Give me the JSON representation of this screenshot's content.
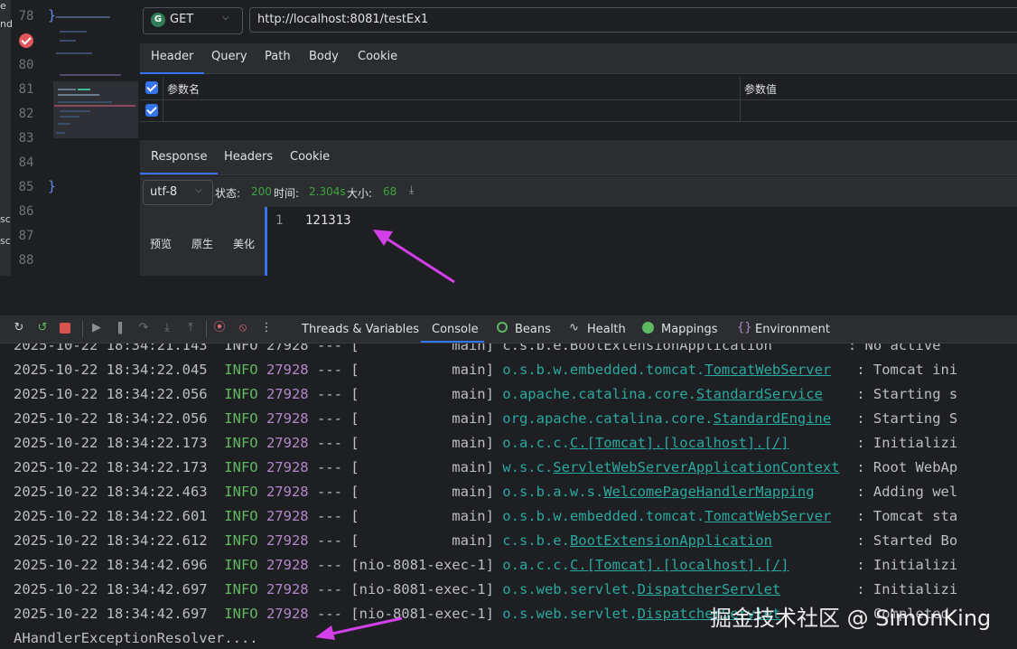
{
  "editor": {
    "line_numbers": [
      "78",
      "80",
      "81",
      "82",
      "83",
      "84",
      "85",
      "86",
      "87",
      "88"
    ],
    "closing_brace": "}",
    "edge_letters": [
      "e",
      "nd",
      "sc",
      "sc"
    ]
  },
  "request": {
    "method": "GET",
    "method_icon_letter": "G",
    "url": "http://localhost:8081/testEx1",
    "tabs": [
      "Header",
      "Query",
      "Path",
      "Body",
      "Cookie"
    ],
    "params_col_name": "参数名",
    "params_col_value": "参数值"
  },
  "response": {
    "tabs": [
      "Response",
      "Headers",
      "Cookie"
    ],
    "encoding": "utf-8",
    "status_label": "状态:",
    "status_value": "200",
    "time_label": "时间:",
    "time_value": "2.304s",
    "size_label": "大小:",
    "size_value": "68",
    "view_tabs": [
      "预览",
      "原生",
      "美化"
    ],
    "line_number": "1",
    "body": "121313"
  },
  "debug": {
    "tabs": [
      "Threads & Variables",
      "Console",
      "Beans",
      "Health",
      "Mappings",
      "Environment"
    ],
    "active_tab": "Console"
  },
  "console": {
    "partial_line": "2025-10-22 18:34:21.143  INFO 27928 --- [           main] c.s.b.e.BootExtensionApplication         : No active",
    "lines": [
      {
        "ts": "2025-10-22 18:34:22.045",
        "level": "INFO",
        "pid": "27928",
        "thread": "[           main]",
        "logger_prefix": "o.s.b.w.embedded.tomcat.",
        "logger_class": "TomcatWebServer",
        "pad": "  ",
        "msg": ": Tomcat ini"
      },
      {
        "ts": "2025-10-22 18:34:22.056",
        "level": "INFO",
        "pid": "27928",
        "thread": "[           main]",
        "logger_prefix": "o.apache.catalina.core.",
        "logger_class": "StandardService",
        "pad": "   ",
        "msg": ": Starting s"
      },
      {
        "ts": "2025-10-22 18:34:22.056",
        "level": "INFO",
        "pid": "27928",
        "thread": "[           main]",
        "logger_prefix": "org.apache.catalina.core.",
        "logger_class": "StandardEngine",
        "pad": "  ",
        "msg": ": Starting S"
      },
      {
        "ts": "2025-10-22 18:34:22.173",
        "level": "INFO",
        "pid": "27928",
        "thread": "[           main]",
        "logger_prefix": "o.a.c.c.",
        "logger_class": "C.[Tomcat].[localhost].[/]",
        "pad": "       ",
        "msg": ": Initializi"
      },
      {
        "ts": "2025-10-22 18:34:22.173",
        "level": "INFO",
        "pid": "27928",
        "thread": "[           main]",
        "logger_prefix": "w.s.c.",
        "logger_class": "ServletWebServerApplicationContext",
        "pad": " ",
        "msg": ": Root WebAp"
      },
      {
        "ts": "2025-10-22 18:34:22.463",
        "level": "INFO",
        "pid": "27928",
        "thread": "[           main]",
        "logger_prefix": "o.s.b.a.w.s.",
        "logger_class": "WelcomePageHandlerMapping",
        "pad": "    ",
        "msg": ": Adding wel"
      },
      {
        "ts": "2025-10-22 18:34:22.601",
        "level": "INFO",
        "pid": "27928",
        "thread": "[           main]",
        "logger_prefix": "o.s.b.w.embedded.tomcat.",
        "logger_class": "TomcatWebServer",
        "pad": "  ",
        "msg": ": Tomcat sta"
      },
      {
        "ts": "2025-10-22 18:34:22.612",
        "level": "INFO",
        "pid": "27928",
        "thread": "[           main]",
        "logger_prefix": "c.s.b.e.",
        "logger_class": "BootExtensionApplication",
        "pad": "         ",
        "msg": ": Started Bo"
      },
      {
        "ts": "2025-10-22 18:34:42.696",
        "level": "INFO",
        "pid": "27928",
        "thread": "[nio-8081-exec-1]",
        "logger_prefix": "o.a.c.c.",
        "logger_class": "C.[Tomcat].[localhost].[/]",
        "pad": "       ",
        "msg": ": Initializi"
      },
      {
        "ts": "2025-10-22 18:34:42.697",
        "level": "INFO",
        "pid": "27928",
        "thread": "[nio-8081-exec-1]",
        "logger_prefix": "o.s.web.servlet.",
        "logger_class": "DispatcherServlet",
        "pad": "        ",
        "msg": ": Initializi"
      },
      {
        "ts": "2025-10-22 18:34:42.697",
        "level": "INFO",
        "pid": "27928",
        "thread": "[nio-8081-exec-1]",
        "logger_prefix": "o.s.web.servlet.",
        "logger_class": "DispatcherServlet",
        "pad": "        ",
        "msg": ": Completed"
      }
    ],
    "last_line": "AHandlerExceptionResolver...."
  },
  "watermark": "掘金技术社区 @ SimonKing",
  "colors": {
    "accent": "#3574f0",
    "status_ok": "#3fa63f",
    "log_info": "#5fb960",
    "log_pid": "#b388c9",
    "log_logger": "#2aa9a0",
    "annotation_arrow": "#d33fe8"
  }
}
